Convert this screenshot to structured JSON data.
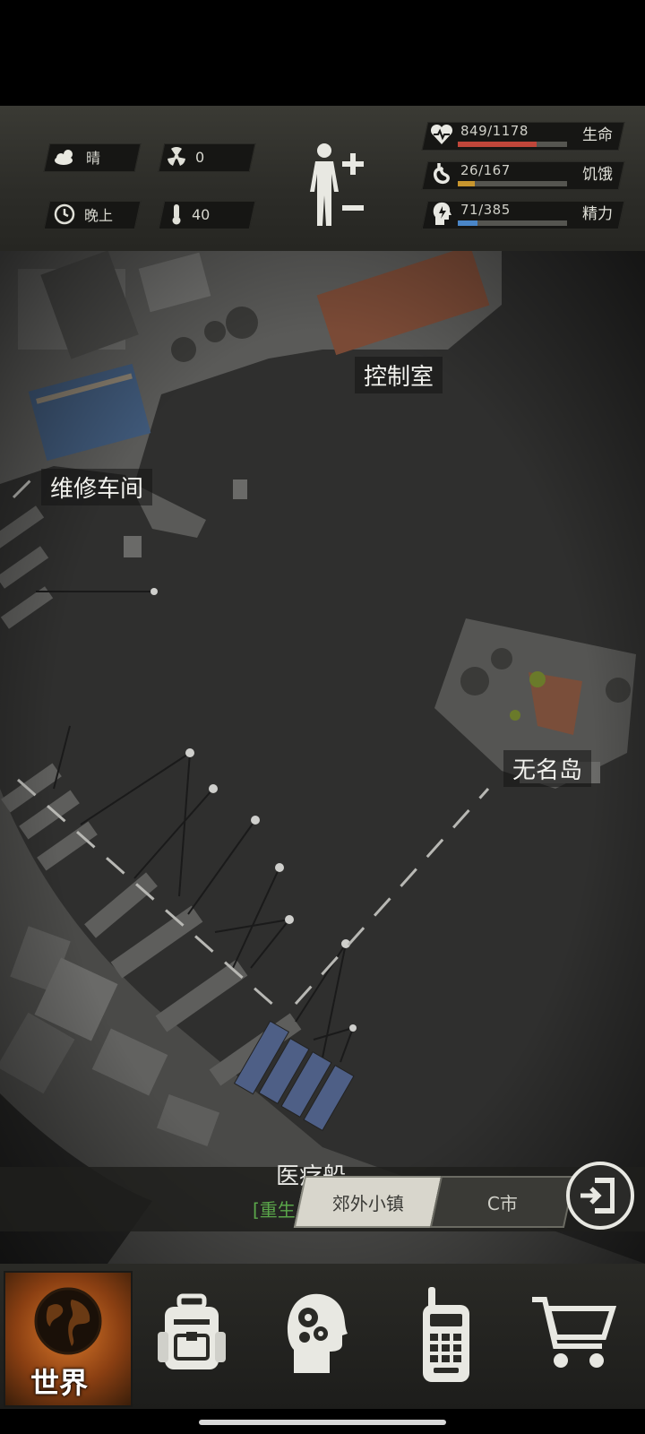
{
  "status": {
    "weather": {
      "icon": "cloud-sun-icon",
      "label": "晴"
    },
    "radiation": {
      "icon": "radiation-icon",
      "value": "0"
    },
    "time_of_day": {
      "icon": "clock-icon",
      "label": "晚上"
    },
    "temperature": {
      "icon": "thermometer-icon",
      "value": "40"
    },
    "body_icon": "human-body-icon",
    "plus_icon": "plus-icon",
    "minus_icon": "minus-icon",
    "stats": [
      {
        "icon": "heart-icon",
        "text": "849/1178",
        "current": 849,
        "max": 1178,
        "label": "生命",
        "color": "#c0463a"
      },
      {
        "icon": "stomach-icon",
        "text": "26/167",
        "current": 26,
        "max": 167,
        "label": "饥饿",
        "color": "#c8962e"
      },
      {
        "icon": "head-energy-icon",
        "text": "71/385",
        "current": 71,
        "max": 385,
        "label": "精力",
        "color": "#4a86c8"
      }
    ]
  },
  "map": {
    "locations": {
      "control_room": "控制室",
      "repair_workshop": "维修车间",
      "nameless_island": "无名岛",
      "hospital_ship": "医疗船",
      "respawn": "[重生"
    }
  },
  "tabs": {
    "suburb_town": "郊外小镇",
    "c_city": "C市",
    "exit_icon": "exit-door-icon"
  },
  "nav": {
    "world_label": "世界",
    "world_icon": "globe-icon",
    "backpack_icon": "backpack-icon",
    "skills_icon": "brain-gears-icon",
    "radio_icon": "walkie-talkie-icon",
    "shop_icon": "cart-icon"
  }
}
